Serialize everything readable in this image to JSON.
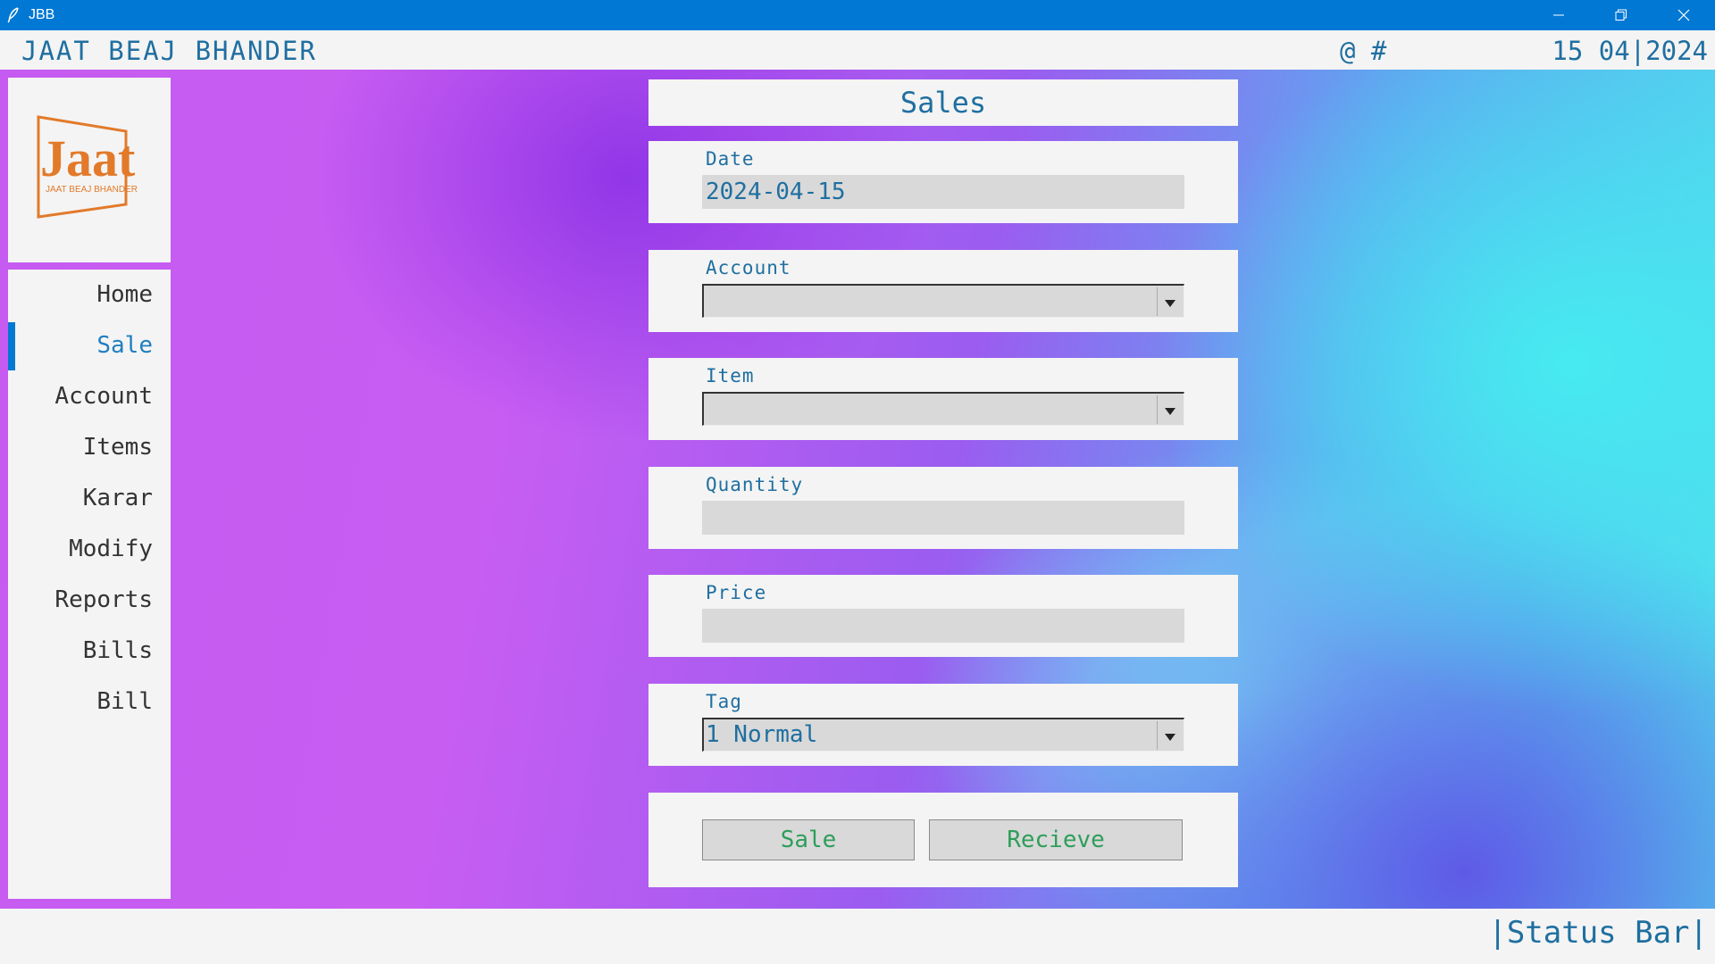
{
  "window": {
    "title": "JBB"
  },
  "header": {
    "app_name": "JAAT BEAJ BHANDER",
    "symbols": "@ #",
    "date": "15 04|2024"
  },
  "logo": {
    "text": "Jaat",
    "subtext": "JAAT BEAJ BHANDER",
    "color": "#e27a2a"
  },
  "sidebar": {
    "items": [
      {
        "label": "Home"
      },
      {
        "label": "Sale",
        "active": true
      },
      {
        "label": "Account"
      },
      {
        "label": "Items"
      },
      {
        "label": "Karar"
      },
      {
        "label": "Modify"
      },
      {
        "label": "Reports"
      },
      {
        "label": "Bills"
      },
      {
        "label": "Bill"
      }
    ]
  },
  "form": {
    "title": "Sales",
    "date": {
      "label": "Date",
      "value": "2024-04-15"
    },
    "account": {
      "label": "Account",
      "value": ""
    },
    "item": {
      "label": "Item",
      "value": ""
    },
    "quantity": {
      "label": "Quantity",
      "value": ""
    },
    "price": {
      "label": "Price",
      "value": ""
    },
    "tag": {
      "label": "Tag",
      "value": "1 Normal"
    },
    "sale_button": "Sale",
    "recieve_button": "Recieve"
  },
  "status": {
    "text": "|Status Bar|"
  },
  "colors": {
    "accent": "#0078d4",
    "text_blue": "#1f6fa0",
    "button_text": "#2e9e5b"
  }
}
